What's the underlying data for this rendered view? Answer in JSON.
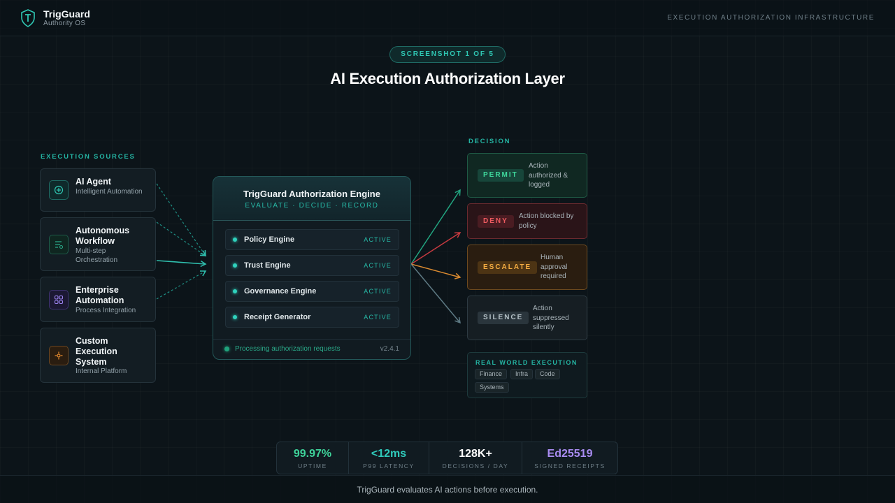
{
  "header": {
    "brand_name": "TrigGuard",
    "brand_sub": "Authority OS",
    "tagline": "EXECUTION AUTHORIZATION INFRASTRUCTURE"
  },
  "hero": {
    "pill": "SCREENSHOT 1 OF 5",
    "title": "AI Execution Authorization Layer"
  },
  "sources": {
    "label": "EXECUTION SOURCES",
    "items": [
      {
        "title": "AI Agent",
        "sub": "Intelligent Automation",
        "icon": "plus-circle-icon"
      },
      {
        "title": "Autonomous Workflow",
        "sub": "Multi-step Orchestration",
        "icon": "workflow-icon"
      },
      {
        "title": "Enterprise Automation",
        "sub": "Process Integration",
        "icon": "grid-icon"
      },
      {
        "title": "Custom Execution System",
        "sub": "Internal Platform",
        "icon": "target-icon"
      }
    ]
  },
  "engine": {
    "title": "TrigGuard Authorization Engine",
    "tagline": "EVALUATE · DECIDE · RECORD",
    "modules": [
      {
        "name": "Policy Engine",
        "status": "ACTIVE"
      },
      {
        "name": "Trust Engine",
        "status": "ACTIVE"
      },
      {
        "name": "Governance Engine",
        "status": "ACTIVE"
      },
      {
        "name": "Receipt Generator",
        "status": "ACTIVE"
      }
    ],
    "footer_text": "Processing authorization requests",
    "version": "v2.4.1"
  },
  "decision": {
    "label": "DECISION",
    "items": [
      {
        "badge": "PERMIT",
        "desc": "Action authorized & logged",
        "color": "#2fd08e"
      },
      {
        "badge": "DENY",
        "desc": "Action blocked by policy",
        "color": "#e0464a"
      },
      {
        "badge": "ESCALATE",
        "desc": "Human approval required",
        "color": "#f0a23a"
      },
      {
        "badge": "SILENCE",
        "desc": "Action suppressed silently",
        "color": "#9aa7ad"
      }
    ]
  },
  "real_world": {
    "label": "REAL WORLD EXECUTION",
    "chips": [
      "Finance",
      "Infra",
      "Code",
      "Systems"
    ]
  },
  "stats": [
    {
      "value": "99.97%",
      "label": "UPTIME",
      "color": "#3ed39a"
    },
    {
      "value": "<12ms",
      "label": "P99 LATENCY",
      "color": "#2fcabb"
    },
    {
      "value": "128K+",
      "label": "DECISIONS / DAY",
      "color": "#ffffff"
    },
    {
      "value": "Ed25519",
      "label": "SIGNED RECEIPTS",
      "color": "#a98cf2"
    }
  ],
  "footer": {
    "text": "TrigGuard evaluates AI actions before execution."
  },
  "colors": {
    "accent": "#2fc8b4",
    "background": "#0c1419"
  }
}
